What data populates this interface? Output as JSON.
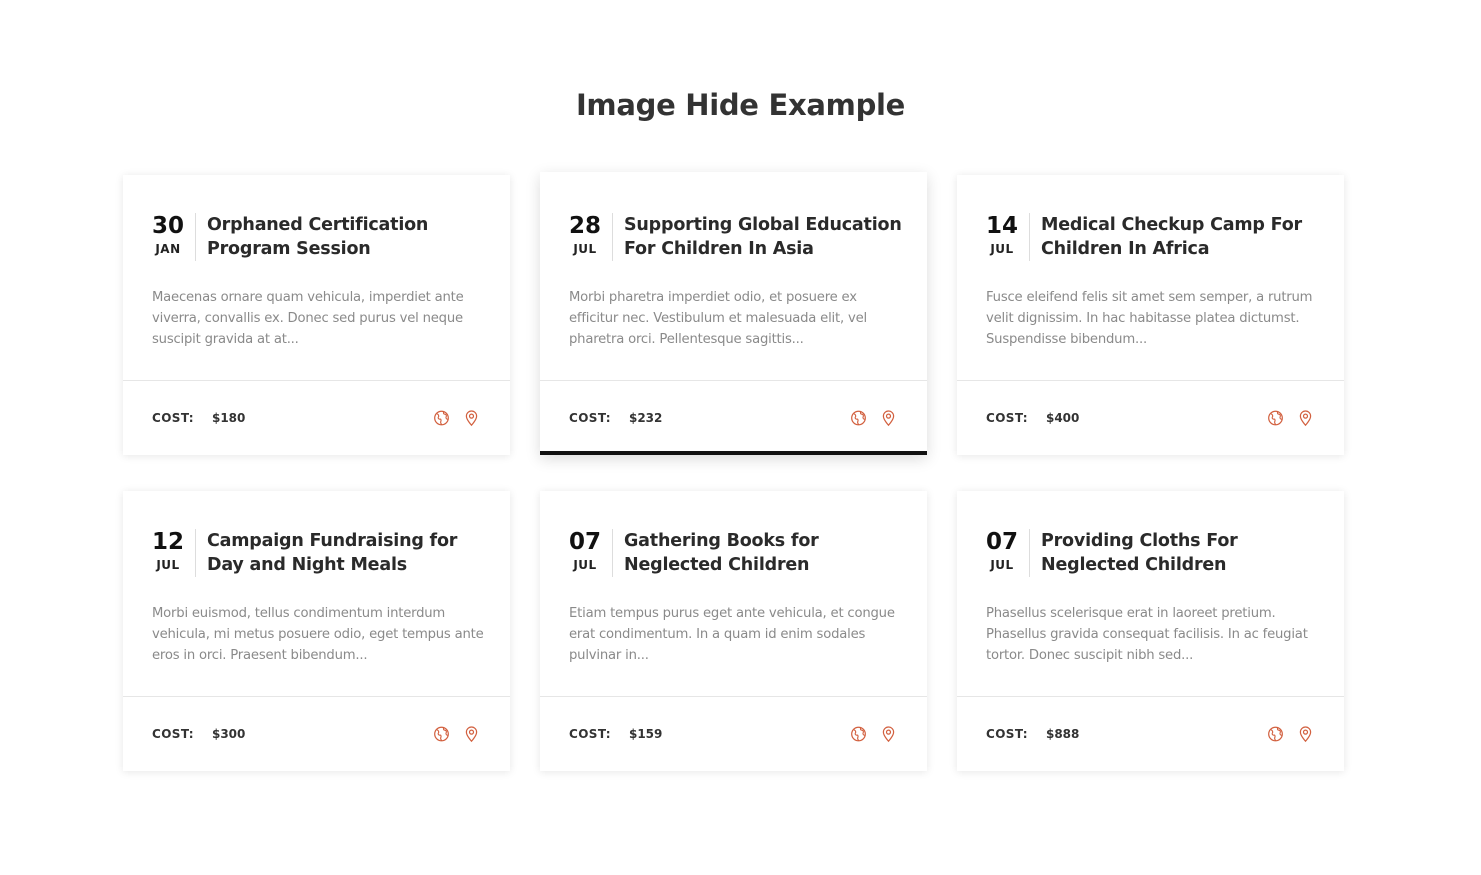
{
  "page": {
    "title": "Image Hide Example"
  },
  "colors": {
    "accent": "#d2603f",
    "active_border": "#111111"
  },
  "icons": [
    "globe-icon",
    "map-pin-icon"
  ],
  "cards": [
    {
      "day": "30",
      "month": "JAN",
      "title": "Orphaned Certification Program Session",
      "description": "Maecenas ornare quam vehicula, imperdiet ante viverra, convallis ex. Donec sed purus vel neque suscipit gravida at at...",
      "cost_label": "COST:",
      "cost": "$180"
    },
    {
      "day": "28",
      "month": "JUL",
      "title": "Supporting Global Education For Children In Asia",
      "description": "Morbi pharetra imperdiet odio, et posuere ex efficitur nec. Vestibulum et malesuada elit, vel pharetra orci. Pellentesque sagittis...",
      "cost_label": "COST:",
      "cost": "$232"
    },
    {
      "day": "14",
      "month": "JUL",
      "title": "Medical Checkup Camp For Children In Africa",
      "description": "Fusce eleifend felis sit amet sem semper, a rutrum velit dignissim. In hac habitasse platea dictumst. Suspendisse bibendum...",
      "cost_label": "COST:",
      "cost": "$400"
    },
    {
      "day": "12",
      "month": "JUL",
      "title": "Campaign Fundraising for Day and Night Meals",
      "description": "Morbi euismod, tellus condimentum interdum vehicula, mi metus posuere odio, eget tempus ante eros in orci. Praesent bibendum...",
      "cost_label": "COST:",
      "cost": "$300"
    },
    {
      "day": "07",
      "month": "JUL",
      "title": "Gathering Books for Neglected Children",
      "description": "Etiam tempus purus eget ante vehicula, et congue erat condimentum. In a quam id enim sodales pulvinar in...",
      "cost_label": "COST:",
      "cost": "$159"
    },
    {
      "day": "07",
      "month": "JUL",
      "title": "Providing Cloths For Neglected Children",
      "description": "Phasellus scelerisque erat in laoreet pretium. Phasellus gravida consequat facilisis. In ac feugiat tortor. Donec suscipit nibh sed...",
      "cost_label": "COST:",
      "cost": "$888"
    }
  ]
}
